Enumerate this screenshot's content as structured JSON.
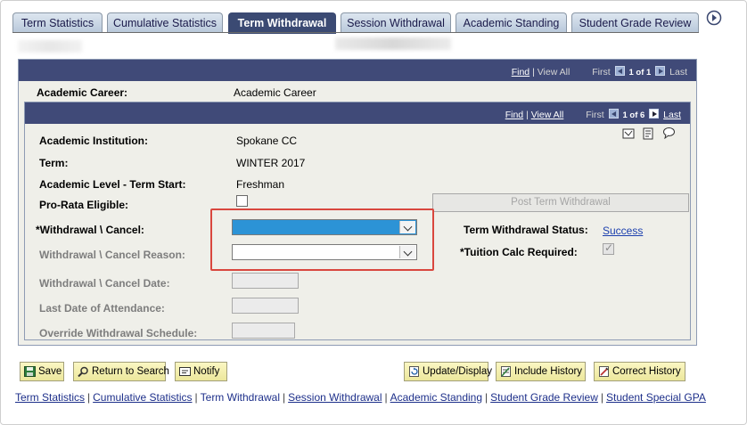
{
  "tabs": [
    {
      "label": "Term Statistics",
      "active": false
    },
    {
      "label": "Cumulative Statistics",
      "active": false
    },
    {
      "label": "Term Withdrawal",
      "active": true
    },
    {
      "label": "Session Withdrawal",
      "active": false
    },
    {
      "label": "Academic Standing",
      "active": false
    },
    {
      "label": "Student Grade Review",
      "active": false
    }
  ],
  "career_header": {
    "find": "Find",
    "sep": "|",
    "view_all": "View All",
    "first": "First",
    "page": "1 of 1",
    "last": "Last"
  },
  "career": {
    "label": "Academic Career:",
    "value": "Academic Career"
  },
  "term_header": {
    "find": "Find",
    "sep": "|",
    "view_all": "View All",
    "first": "First",
    "page": "1 of 6",
    "last": "Last"
  },
  "fields": {
    "institution_label": "Academic Institution:",
    "institution_value": "Spokane CC",
    "term_label": "Term:",
    "term_value": "WINTER 2017",
    "level_label": "Academic Level - Term Start:",
    "level_value": "Freshman",
    "prorata_label": "Pro-Rata Eligible:",
    "withdrawal_label": "*Withdrawal \\ Cancel:",
    "reason_label": "Withdrawal \\ Cancel Reason:",
    "date_label": "Withdrawal \\ Cancel Date:",
    "last_attend_label": "Last Date of Attendance:",
    "override_label": "Override Withdrawal Schedule:",
    "post_button": "Post Term Withdrawal",
    "status_label": "Term Withdrawal Status:",
    "status_value": "Success",
    "tuition_label": "*Tuition Calc Required:"
  },
  "toolbar": {
    "save": "Save",
    "return": "Return to Search",
    "notify": "Notify",
    "update": "Update/Display",
    "include_history": "Include History",
    "correct_history": "Correct History"
  },
  "footer": {
    "links": [
      {
        "label": "Term Statistics",
        "current": false
      },
      {
        "label": "Cumulative Statistics",
        "current": false
      },
      {
        "label": "Term Withdrawal",
        "current": true
      },
      {
        "label": "Session Withdrawal",
        "current": false
      },
      {
        "label": "Academic Standing",
        "current": false
      },
      {
        "label": "Student Grade Review",
        "current": false
      },
      {
        "label": "Student Special GPA",
        "current": false
      }
    ],
    "sep": "|"
  },
  "colors": {
    "header_bar": "#404a78",
    "active_tab": "#3b4a73",
    "selected_dropdown": "#2c93d6",
    "highlight_box": "#d9473e",
    "link": "#1d2f8a"
  },
  "icons": [
    "tab-scroll-right-icon",
    "grid-link-icon",
    "report-icon",
    "comment-icon",
    "save-icon",
    "search-icon",
    "notify-icon",
    "refresh-icon",
    "include-history-icon",
    "correct-history-icon"
  ]
}
